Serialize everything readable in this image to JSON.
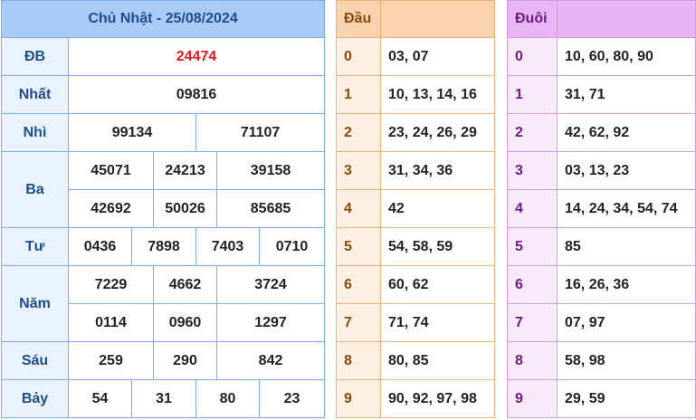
{
  "results": {
    "title": "Chủ Nhật - 25/08/2024",
    "rows": [
      {
        "label": "ĐB",
        "values": [
          "24474"
        ]
      },
      {
        "label": "Nhất",
        "values": [
          "09816"
        ]
      },
      {
        "label": "Nhì",
        "values": [
          "99134",
          "71107"
        ]
      },
      {
        "label": "Ba",
        "values": [
          "45071",
          "24213",
          "39158",
          "42692",
          "50026",
          "85685"
        ]
      },
      {
        "label": "Tư",
        "values": [
          "0436",
          "7898",
          "7403",
          "0710"
        ]
      },
      {
        "label": "Năm",
        "values": [
          "7229",
          "4662",
          "3724",
          "0114",
          "0960",
          "1297"
        ]
      },
      {
        "label": "Sáu",
        "values": [
          "259",
          "290",
          "842"
        ]
      },
      {
        "label": "Bảy",
        "values": [
          "54",
          "31",
          "80",
          "23"
        ]
      }
    ]
  },
  "dau": {
    "header": "Đầu",
    "rows": [
      {
        "key": "0",
        "value": "03, 07"
      },
      {
        "key": "1",
        "value": "10, 13, 14, 16"
      },
      {
        "key": "2",
        "value": "23, 24, 26, 29"
      },
      {
        "key": "3",
        "value": "31, 34, 36"
      },
      {
        "key": "4",
        "value": "42"
      },
      {
        "key": "5",
        "value": "54, 58, 59"
      },
      {
        "key": "6",
        "value": "60, 62"
      },
      {
        "key": "7",
        "value": "71, 74"
      },
      {
        "key": "8",
        "value": "80, 85"
      },
      {
        "key": "9",
        "value": "90, 92, 97, 98"
      }
    ]
  },
  "duoi": {
    "header": "Đuôi",
    "rows": [
      {
        "key": "0",
        "value": "10, 60, 80, 90"
      },
      {
        "key": "1",
        "value": "31, 71"
      },
      {
        "key": "2",
        "value": "42, 62, 92"
      },
      {
        "key": "3",
        "value": "03, 13, 23"
      },
      {
        "key": "4",
        "value": "14, 24, 34, 54, 74"
      },
      {
        "key": "5",
        "value": "85"
      },
      {
        "key": "6",
        "value": "16, 26, 36"
      },
      {
        "key": "7",
        "value": "07, 97"
      },
      {
        "key": "8",
        "value": "58, 98"
      },
      {
        "key": "9",
        "value": "29, 59"
      }
    ]
  },
  "colors": {
    "special_prize": "#e8161d",
    "results_border": "#7aaef0",
    "dau_border": "#f0b27a",
    "duoi_border": "#d39be0"
  }
}
